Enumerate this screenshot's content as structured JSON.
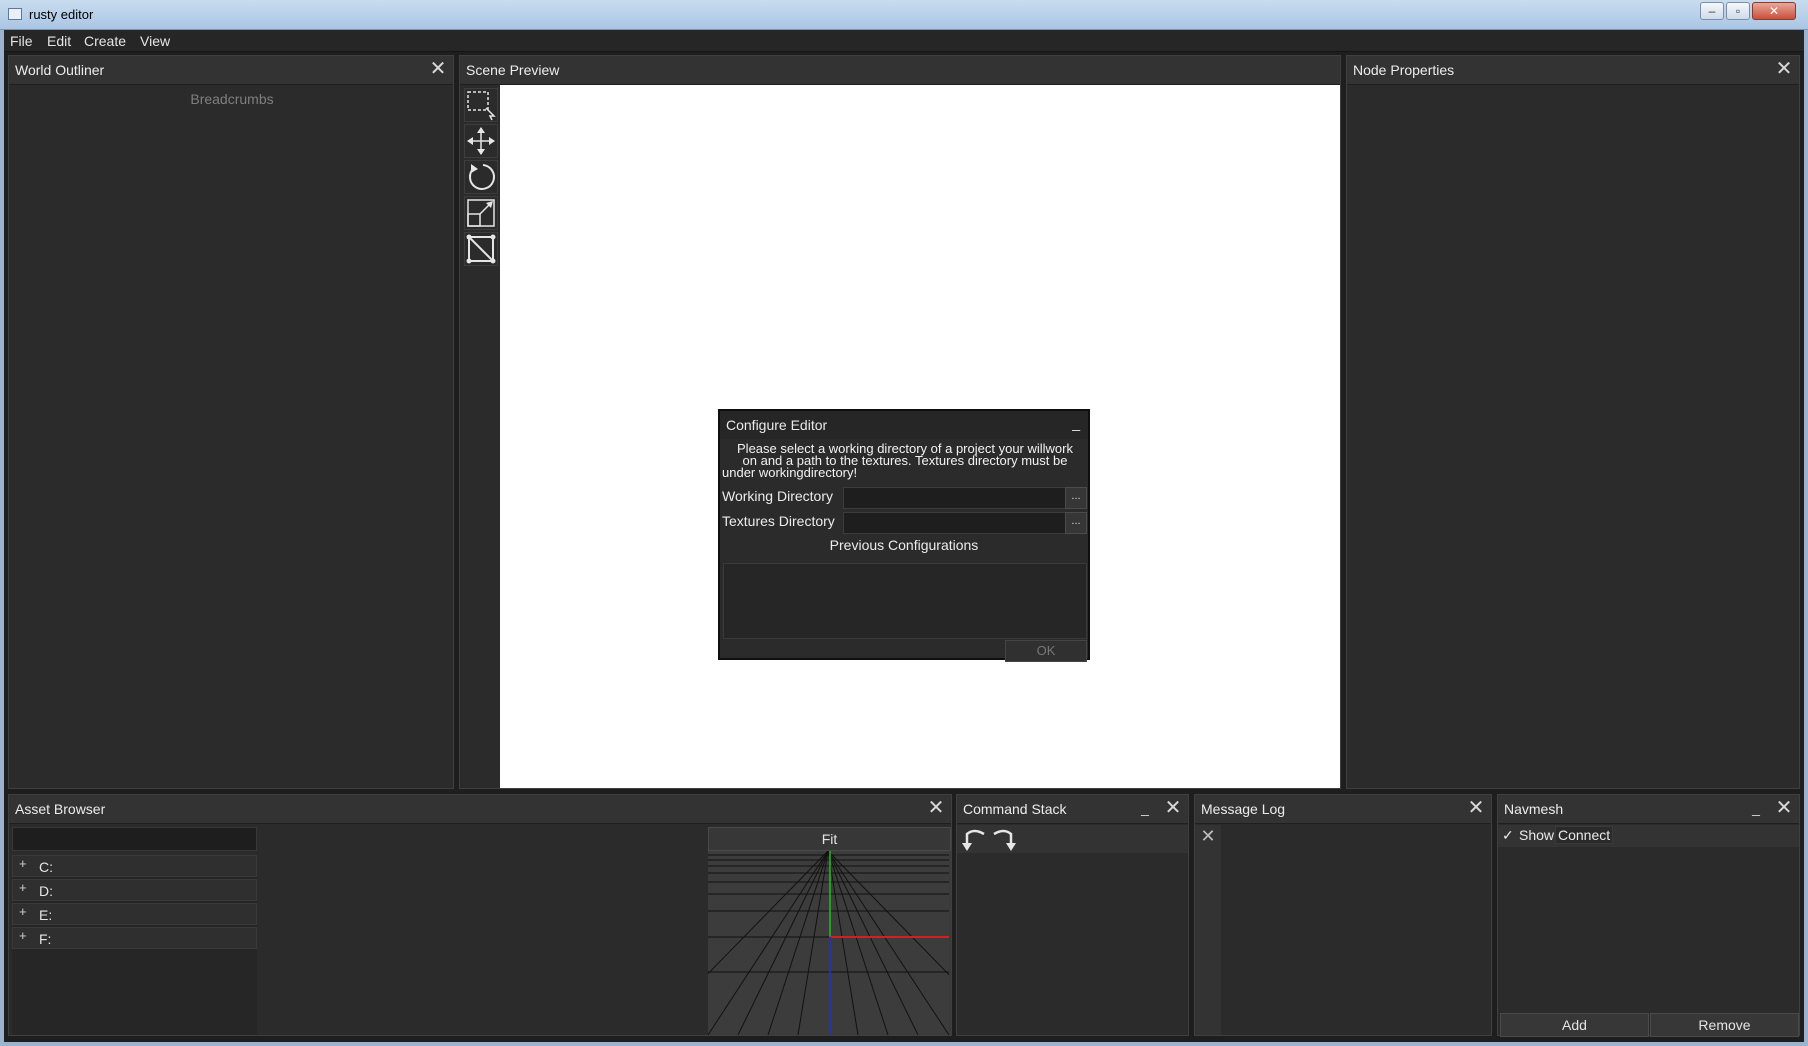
{
  "window": {
    "title": "rusty editor"
  },
  "menu": {
    "items": [
      "File",
      "Edit",
      "Create",
      "View"
    ]
  },
  "world_outliner": {
    "title": "World Outliner",
    "breadcrumbs": "Breadcrumbs"
  },
  "scene_preview": {
    "title": "Scene Preview",
    "tools": [
      "select-icon",
      "move-icon",
      "rotate-icon",
      "scale-icon",
      "navmesh-edit-icon"
    ]
  },
  "node_properties": {
    "title": "Node Properties"
  },
  "configure_dialog": {
    "title": "Configure Editor",
    "minimize": "_",
    "message_line1": "Please select a working directory of a project your willwork",
    "message_line2": "on and a path to the textures. Textures directory must be",
    "message_line3": "under workingdirectory!",
    "working_dir_label": "Working Directory",
    "working_dir_value": "",
    "textures_dir_label": "Textures Directory",
    "textures_dir_value": "",
    "browse_label": "...",
    "previous_configurations": "Previous Configurations",
    "ok_label": "OK"
  },
  "asset_browser": {
    "title": "Asset Browser",
    "search_value": "",
    "drives": [
      "C:",
      "D:",
      "E:",
      "F:"
    ],
    "preview_fit": "Fit"
  },
  "command_stack": {
    "title": "Command Stack",
    "minimize": "_"
  },
  "message_log": {
    "title": "Message Log"
  },
  "navmesh": {
    "title": "Navmesh",
    "minimize": "_",
    "show_label": "Show",
    "show_checked": true,
    "connect_label": "Connect",
    "add_label": "Add",
    "remove_label": "Remove"
  },
  "colors": {
    "axis_x": "#d02020",
    "axis_y": "#20c020",
    "axis_z": "#2030d0",
    "viewport": "#ffffff"
  }
}
